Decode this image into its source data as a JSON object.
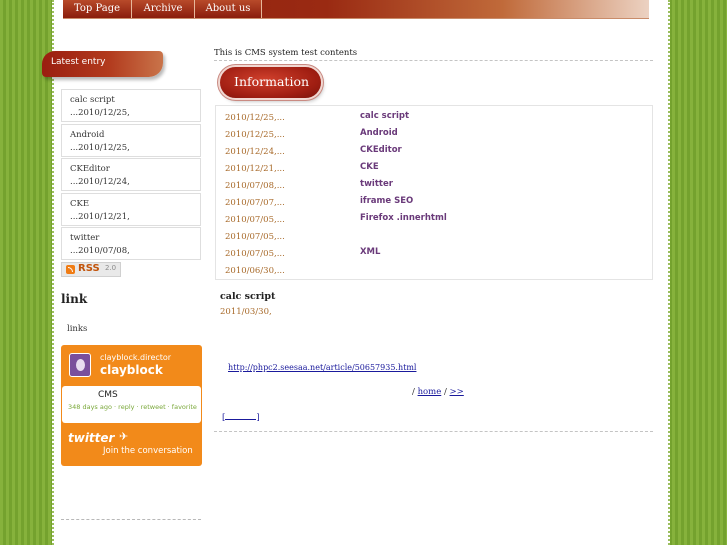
{
  "nav": [
    {
      "label": "Top Page"
    },
    {
      "label": "Archive"
    },
    {
      "label": "About us"
    }
  ],
  "sidebar": {
    "latest_label": "Latest entry",
    "entries": [
      {
        "title": "calc script",
        "date": "...2010/12/25,"
      },
      {
        "title": "Android",
        "date": "...2010/12/25,"
      },
      {
        "title": "CKEditor",
        "date": "...2010/12/24,"
      },
      {
        "title": "CKE",
        "date": "...2010/12/21,"
      },
      {
        "title": "twitter",
        "date": "...2010/07/08,"
      }
    ],
    "rss": {
      "label": "RSS",
      "version": "2.0"
    },
    "link_heading": "link",
    "links_text": "links",
    "twitter": {
      "handle": "clayblock.director",
      "name": "clayblock",
      "tweet": "CMS",
      "meta": "348 days ago · reply · retweet · favorite",
      "logo": "twitter",
      "join": "Join the conversation"
    }
  },
  "main": {
    "header_text": "This is CMS system test contents",
    "info_label": "Information",
    "info_rows": [
      {
        "date": "2010/12/25,...",
        "title": "calc script"
      },
      {
        "date": "2010/12/25,...",
        "title": "Android"
      },
      {
        "date": "2010/12/24,...",
        "title": "CKEditor"
      },
      {
        "date": "2010/12/21,...",
        "title": "CKE"
      },
      {
        "date": "2010/07/08,...",
        "title": "twitter"
      },
      {
        "date": "2010/07/07,...",
        "title": "iframe  SEO"
      },
      {
        "date": "2010/07/05,...",
        "title": "Firefox    .innerhtml"
      },
      {
        "date": "2010/07/05,...",
        "title": ""
      },
      {
        "date": "2010/07/05,...",
        "title": "XML"
      },
      {
        "date": "2010/06/30,...",
        "title": ""
      }
    ],
    "post": {
      "title": "calc script",
      "date": "2011/03/30,",
      "link": "http://phpc2.seesaa.net/article/50657935.html"
    },
    "pager": {
      "separator1": "/",
      "home": "home",
      "separator2": "/",
      "next": ">>"
    },
    "bracket_open": "[",
    "bracket_close": "]"
  }
}
